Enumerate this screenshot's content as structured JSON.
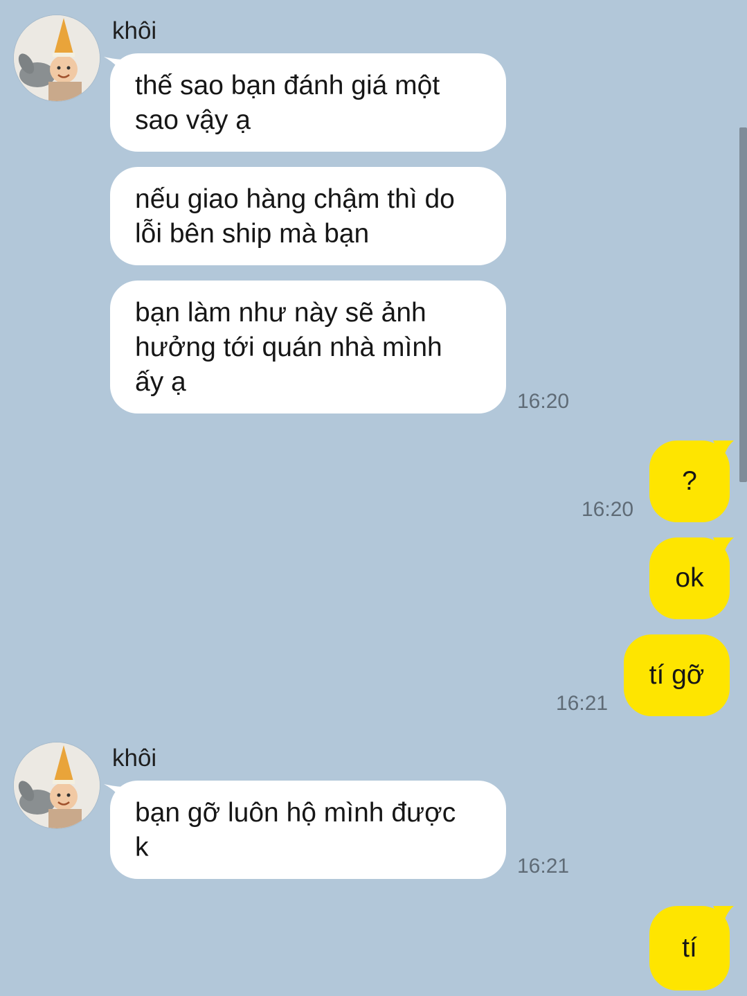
{
  "colors": {
    "background": "#b2c7d9",
    "incoming_bubble": "#ffffff",
    "outgoing_bubble": "#fee500",
    "timestamp": "#5f6b76"
  },
  "sender": {
    "name": "khôi",
    "avatar_icon": "avatar-photo-icon"
  },
  "messages": {
    "m1": "thế sao bạn đánh giá một\nsao vậy ạ",
    "m2": "nếu giao hàng chậm thì do\nlỗi bên ship mà bạn",
    "m3": "bạn làm như này sẽ ảnh\nhưởng tới quán nhà mình\nấy ạ",
    "m3_time": "16:20",
    "m4": "?",
    "m4_time": "16:20",
    "m5": "ok",
    "m6": "tí gỡ",
    "m6_time": "16:21",
    "m7": "bạn gỡ luôn hộ mình được\nk",
    "m7_time": "16:21",
    "m8": "tí"
  }
}
